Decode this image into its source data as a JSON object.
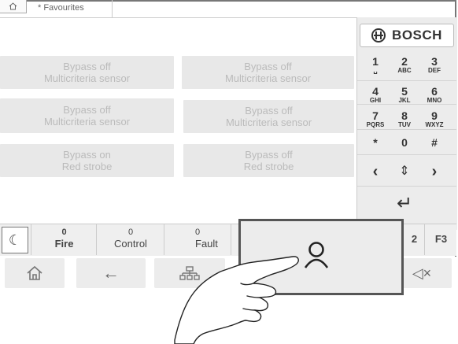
{
  "tabs": {
    "home_icon": "home-icon",
    "active_tab": "* Favourites"
  },
  "tiles": [
    {
      "line1": "Bypass off",
      "line2": "Multicriteria sensor"
    },
    {
      "line1": "Bypass off",
      "line2": "Multicriteria sensor"
    },
    {
      "line1": "Bypass off",
      "line2": "Multicriteria sensor"
    },
    {
      "line1": "Bypass off",
      "line2": "Multicriteria sensor"
    },
    {
      "line1": "Bypass on",
      "line2": "Red strobe"
    },
    {
      "line1": "Bypass off",
      "line2": "Red strobe"
    }
  ],
  "brand": "BOSCH",
  "keypad": [
    {
      "digit": "1",
      "letters": "␣"
    },
    {
      "digit": "2",
      "letters": "ABC"
    },
    {
      "digit": "3",
      "letters": "DEF"
    },
    {
      "digit": "4",
      "letters": "GHI"
    },
    {
      "digit": "5",
      "letters": "JKL"
    },
    {
      "digit": "6",
      "letters": "MNO"
    },
    {
      "digit": "7",
      "letters": "PQRS"
    },
    {
      "digit": "8",
      "letters": "TUV"
    },
    {
      "digit": "9",
      "letters": "WXYZ"
    },
    {
      "digit": "*",
      "letters": ""
    },
    {
      "digit": "0",
      "letters": ""
    },
    {
      "digit": "#",
      "letters": ""
    }
  ],
  "arrows": {
    "left": "‹",
    "updown": "⇕",
    "right": "›",
    "enter": "↵"
  },
  "status": [
    {
      "count": "0",
      "label": "Fire"
    },
    {
      "count": "0",
      "label": "Control"
    },
    {
      "count": "0",
      "label": "Fault"
    }
  ],
  "function_keys": {
    "f2": "2",
    "f3": "F3"
  },
  "nav": {
    "home": "home-icon",
    "back": "←",
    "tree": "tree-icon",
    "mute": "◁×"
  },
  "colors": {
    "accent_border": "#555555",
    "tile_bg": "#e8e8e8",
    "tile_text": "#bbbbbb"
  }
}
